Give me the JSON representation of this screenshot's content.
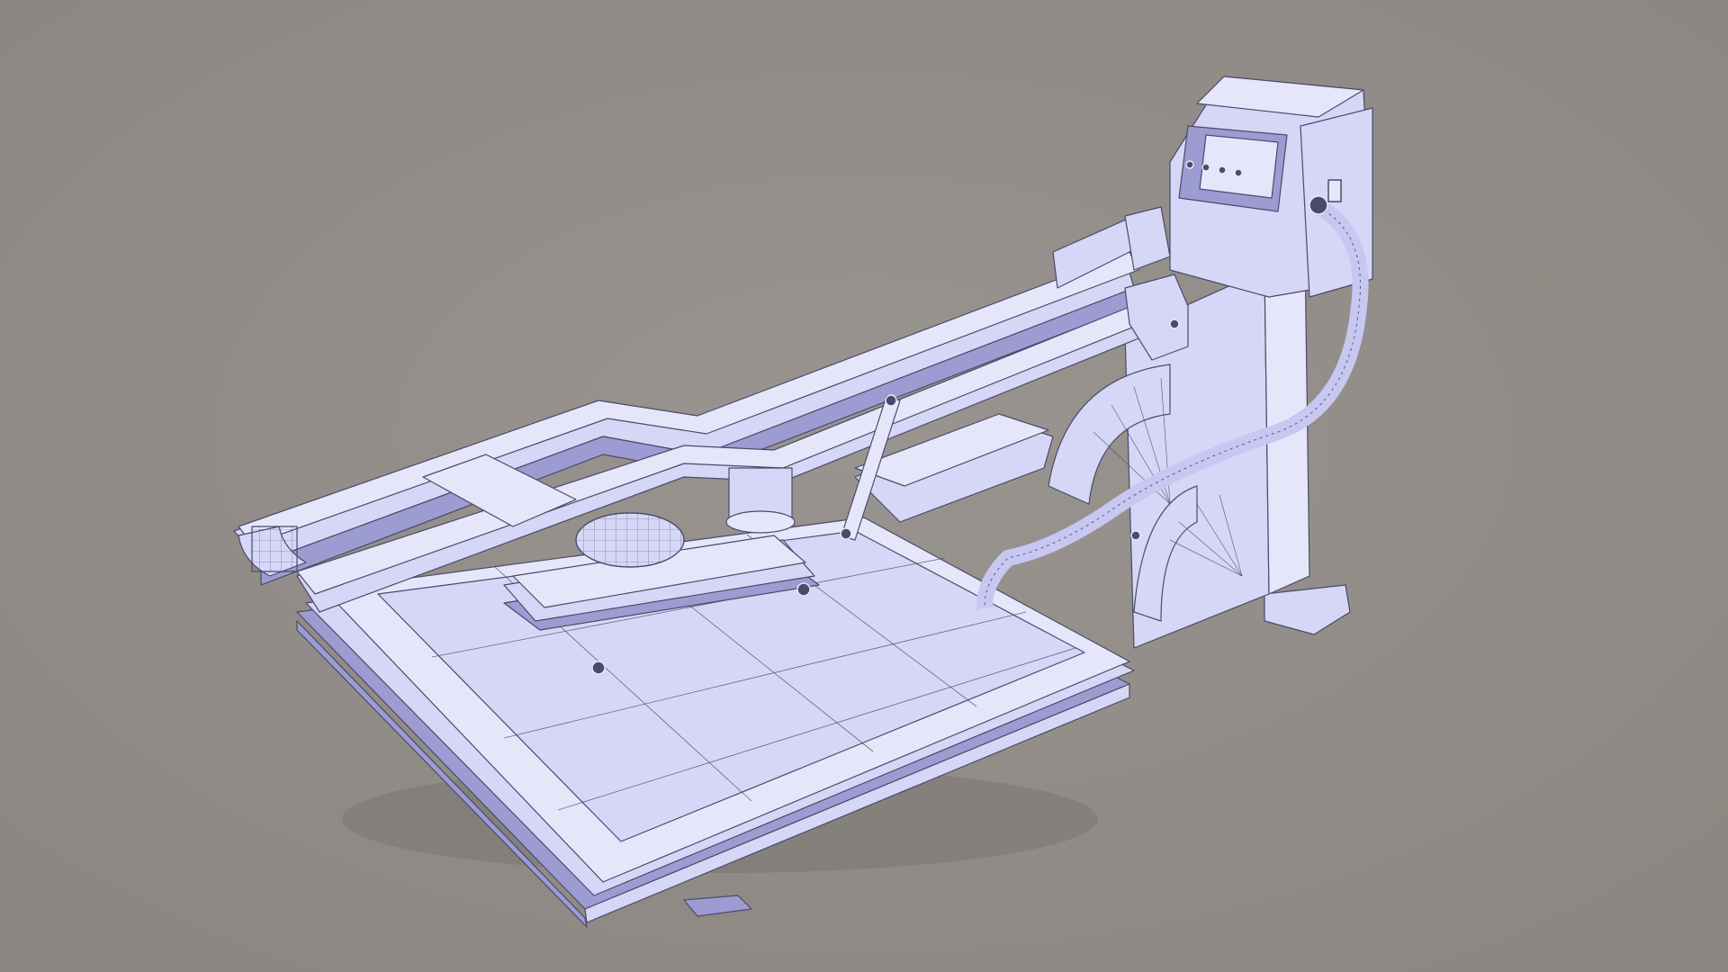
{
  "scene": {
    "subject": "heat-press-machine-wireframe-render",
    "colors": {
      "background": "#8a8580",
      "background_light": "#99948f",
      "model_base": "#c7c7f2",
      "model_highlight": "#e6e6fb",
      "model_face": "#d6d6f6",
      "model_shadow": "#9c9cd2",
      "wire": "#4a4a6a",
      "ground_shadow": "#6e6a66"
    },
    "control_panel_buttons": 4,
    "switch_count": 1
  }
}
